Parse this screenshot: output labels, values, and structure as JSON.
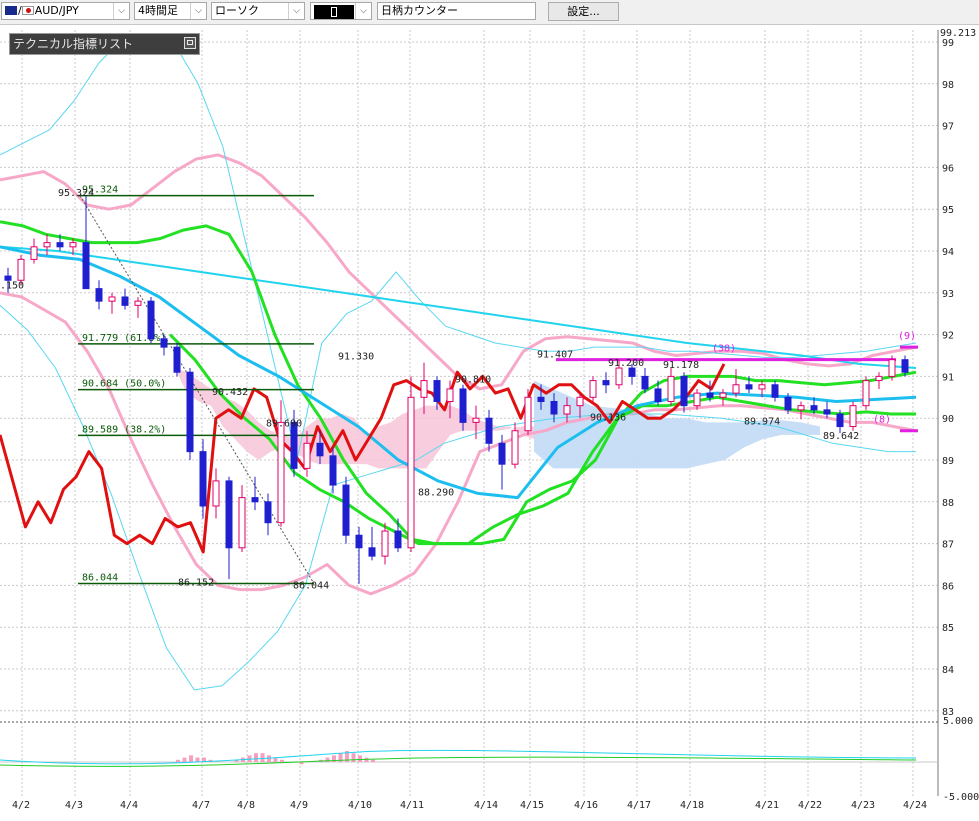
{
  "toolbar": {
    "symbol": "AUD/JPY",
    "timeframe": "4時間足",
    "chart_style": "ローソク",
    "color_sample": "",
    "counter_label": "日柄カウンター",
    "settings_label": "設定..."
  },
  "indicator_panel": {
    "title": "テクニカル指標リスト"
  },
  "colors": {
    "up_candle": "#ffffff",
    "down_candle": "#1f1fd0",
    "grid": "#c9c9c9",
    "cloud_bull": "#f7c5d8",
    "cloud_bear": "#c4dcf5",
    "bb_outer": "#f7a8c8",
    "bb_inner": "#59d7f0",
    "ma_short": "#22d3ee",
    "ma_mid": "#22e022",
    "tenkan": "#e01010",
    "fib": "#0a5a0a",
    "counter": "#e020e0"
  },
  "chart_data": {
    "type": "candlestick",
    "instrument": "AUD/JPY",
    "timeframe": "4h",
    "yticks": [
      99,
      98,
      97,
      96,
      95,
      94,
      93,
      92,
      91,
      90,
      89,
      88,
      87,
      86,
      85,
      84,
      83
    ],
    "top_label": "99.213",
    "x_labels": [
      "4/2",
      "4/3",
      "4/4",
      "4/7",
      "4/8",
      "4/9",
      "4/10",
      "4/11",
      "4/14",
      "4/15",
      "4/16",
      "4/17",
      "4/18",
      "4/21",
      "4/22",
      "4/23",
      "4/24"
    ],
    "oscillator": {
      "upper": "5.000",
      "lower": "-5.000"
    },
    "fibonacci": [
      {
        "label": "95.324",
        "value": 95.324
      },
      {
        "label": "91.779 (61.8%)",
        "value": 91.779
      },
      {
        "label": "90.684 (50.0%)",
        "value": 90.684
      },
      {
        "label": "89.589 (38.2%)",
        "value": 89.589
      },
      {
        "label": "86.044",
        "value": 86.044
      }
    ],
    "price_labels": [
      {
        "text": "95.324",
        "value": 95.32
      },
      {
        "text": ".150",
        "value": 93.1
      },
      {
        "text": "86.152",
        "value": 86.0
      },
      {
        "text": "90.432",
        "value": 90.55
      },
      {
        "text": "89.690",
        "value": 89.8
      },
      {
        "text": "86.044",
        "value": 85.92
      },
      {
        "text": "91.330",
        "value": 91.4
      },
      {
        "text": "88.290",
        "value": 88.15
      },
      {
        "text": "90.810",
        "value": 90.85
      },
      {
        "text": "91.407",
        "value": 91.45
      },
      {
        "text": "91.200",
        "value": 91.25
      },
      {
        "text": "90.136",
        "value": 89.95
      },
      {
        "text": "91.178",
        "value": 91.2
      },
      {
        "text": "89.974",
        "value": 89.85
      },
      {
        "text": "89.642",
        "value": 89.5
      }
    ],
    "counter_labels": [
      {
        "text": "(38)",
        "value": 91.6
      },
      {
        "text": "(9)",
        "value": 91.9
      },
      {
        "text": "(8)",
        "value": 89.9
      }
    ],
    "counter_levels": [
      91.4,
      91.7,
      89.7
    ],
    "candles": [
      {
        "o": 93.4,
        "h": 93.6,
        "l": 93.0,
        "c": 93.3
      },
      {
        "o": 93.3,
        "h": 93.9,
        "l": 93.2,
        "c": 93.8
      },
      {
        "o": 93.8,
        "h": 94.3,
        "l": 93.7,
        "c": 94.1
      },
      {
        "o": 94.1,
        "h": 94.4,
        "l": 93.9,
        "c": 94.2
      },
      {
        "o": 94.2,
        "h": 94.4,
        "l": 94.0,
        "c": 94.1
      },
      {
        "o": 94.1,
        "h": 94.3,
        "l": 93.9,
        "c": 94.2
      },
      {
        "o": 94.2,
        "h": 95.32,
        "l": 94.0,
        "c": 93.1
      },
      {
        "o": 93.1,
        "h": 93.3,
        "l": 92.6,
        "c": 92.8
      },
      {
        "o": 92.8,
        "h": 93.0,
        "l": 92.5,
        "c": 92.9
      },
      {
        "o": 92.9,
        "h": 93.1,
        "l": 92.6,
        "c": 92.7
      },
      {
        "o": 92.7,
        "h": 92.9,
        "l": 92.4,
        "c": 92.8
      },
      {
        "o": 92.8,
        "h": 92.9,
        "l": 91.8,
        "c": 91.9
      },
      {
        "o": 91.9,
        "h": 92.0,
        "l": 91.5,
        "c": 91.7
      },
      {
        "o": 91.7,
        "h": 91.8,
        "l": 91.0,
        "c": 91.1
      },
      {
        "o": 91.1,
        "h": 91.2,
        "l": 89.0,
        "c": 89.2
      },
      {
        "o": 89.2,
        "h": 89.5,
        "l": 87.6,
        "c": 87.9
      },
      {
        "o": 87.9,
        "h": 88.8,
        "l": 87.6,
        "c": 88.5
      },
      {
        "o": 88.5,
        "h": 88.6,
        "l": 86.15,
        "c": 86.9
      },
      {
        "o": 86.9,
        "h": 88.4,
        "l": 86.8,
        "c": 88.1
      },
      {
        "o": 88.1,
        "h": 88.6,
        "l": 87.8,
        "c": 88.0
      },
      {
        "o": 88.0,
        "h": 88.2,
        "l": 87.2,
        "c": 87.5
      },
      {
        "o": 87.5,
        "h": 90.43,
        "l": 87.4,
        "c": 89.9
      },
      {
        "o": 89.9,
        "h": 90.2,
        "l": 88.6,
        "c": 88.8
      },
      {
        "o": 88.8,
        "h": 89.69,
        "l": 88.6,
        "c": 89.4
      },
      {
        "o": 89.4,
        "h": 89.7,
        "l": 88.9,
        "c": 89.1
      },
      {
        "o": 89.1,
        "h": 89.3,
        "l": 88.2,
        "c": 88.4
      },
      {
        "o": 88.4,
        "h": 88.6,
        "l": 87.0,
        "c": 87.2
      },
      {
        "o": 87.2,
        "h": 87.4,
        "l": 86.04,
        "c": 86.9
      },
      {
        "o": 86.9,
        "h": 87.4,
        "l": 86.6,
        "c": 86.7
      },
      {
        "o": 86.7,
        "h": 87.5,
        "l": 86.5,
        "c": 87.3
      },
      {
        "o": 87.3,
        "h": 87.6,
        "l": 86.8,
        "c": 86.9
      },
      {
        "o": 86.9,
        "h": 91.0,
        "l": 86.8,
        "c": 90.5
      },
      {
        "o": 90.5,
        "h": 91.33,
        "l": 90.1,
        "c": 90.9
      },
      {
        "o": 90.9,
        "h": 91.0,
        "l": 90.2,
        "c": 90.4
      },
      {
        "o": 90.4,
        "h": 90.9,
        "l": 90.0,
        "c": 90.7
      },
      {
        "o": 90.7,
        "h": 90.8,
        "l": 89.7,
        "c": 89.9
      },
      {
        "o": 89.9,
        "h": 90.3,
        "l": 89.5,
        "c": 90.0
      },
      {
        "o": 90.0,
        "h": 90.2,
        "l": 89.2,
        "c": 89.4
      },
      {
        "o": 89.4,
        "h": 89.6,
        "l": 88.29,
        "c": 88.9
      },
      {
        "o": 88.9,
        "h": 89.9,
        "l": 88.8,
        "c": 89.7
      },
      {
        "o": 89.7,
        "h": 90.7,
        "l": 89.6,
        "c": 90.5
      },
      {
        "o": 90.5,
        "h": 90.81,
        "l": 90.2,
        "c": 90.4
      },
      {
        "o": 90.4,
        "h": 90.6,
        "l": 89.9,
        "c": 90.1
      },
      {
        "o": 90.1,
        "h": 90.5,
        "l": 89.9,
        "c": 90.3
      },
      {
        "o": 90.3,
        "h": 90.6,
        "l": 90.0,
        "c": 90.5
      },
      {
        "o": 90.5,
        "h": 91.0,
        "l": 90.4,
        "c": 90.9
      },
      {
        "o": 90.9,
        "h": 91.1,
        "l": 90.6,
        "c": 90.8
      },
      {
        "o": 90.8,
        "h": 91.407,
        "l": 90.7,
        "c": 91.2
      },
      {
        "o": 91.2,
        "h": 91.3,
        "l": 90.8,
        "c": 91.0
      },
      {
        "o": 91.0,
        "h": 91.2,
        "l": 90.6,
        "c": 90.7
      },
      {
        "o": 90.7,
        "h": 90.9,
        "l": 90.3,
        "c": 90.4
      },
      {
        "o": 90.4,
        "h": 91.2,
        "l": 90.3,
        "c": 91.0
      },
      {
        "o": 91.0,
        "h": 91.1,
        "l": 90.136,
        "c": 90.3
      },
      {
        "o": 90.3,
        "h": 90.7,
        "l": 90.2,
        "c": 90.6
      },
      {
        "o": 90.6,
        "h": 90.9,
        "l": 90.4,
        "c": 90.5
      },
      {
        "o": 90.5,
        "h": 90.7,
        "l": 90.3,
        "c": 90.6
      },
      {
        "o": 90.6,
        "h": 91.178,
        "l": 90.5,
        "c": 90.8
      },
      {
        "o": 90.8,
        "h": 91.0,
        "l": 90.6,
        "c": 90.7
      },
      {
        "o": 90.7,
        "h": 90.9,
        "l": 90.5,
        "c": 90.8
      },
      {
        "o": 90.8,
        "h": 90.9,
        "l": 90.4,
        "c": 90.5
      },
      {
        "o": 90.5,
        "h": 90.6,
        "l": 90.1,
        "c": 90.2
      },
      {
        "o": 90.2,
        "h": 90.4,
        "l": 89.974,
        "c": 90.3
      },
      {
        "o": 90.3,
        "h": 90.5,
        "l": 90.1,
        "c": 90.2
      },
      {
        "o": 90.2,
        "h": 90.4,
        "l": 90.0,
        "c": 90.1
      },
      {
        "o": 90.1,
        "h": 90.2,
        "l": 89.642,
        "c": 89.8
      },
      {
        "o": 89.8,
        "h": 90.4,
        "l": 89.7,
        "c": 90.3
      },
      {
        "o": 90.3,
        "h": 91.0,
        "l": 90.2,
        "c": 90.9
      },
      {
        "o": 90.9,
        "h": 91.1,
        "l": 90.7,
        "c": 91.0
      },
      {
        "o": 91.0,
        "h": 91.5,
        "l": 90.9,
        "c": 91.4
      },
      {
        "o": 91.4,
        "h": 91.5,
        "l": 91.0,
        "c": 91.1
      }
    ],
    "bb_upper": [
      95.7,
      95.8,
      95.9,
      95.6,
      95.1,
      95.0,
      95.1,
      95.5,
      95.9,
      96.2,
      96.3,
      96.1,
      95.8,
      95.3,
      94.8,
      94.2,
      93.5,
      93.0,
      92.5,
      92.0,
      91.5,
      91.0,
      90.7,
      90.8,
      91.6,
      91.9,
      91.95,
      91.9,
      91.85,
      91.8,
      91.6,
      91.5,
      91.55,
      91.6,
      91.6,
      91.55,
      91.4,
      91.3,
      91.25,
      91.3,
      91.5,
      91.6,
      91.7
    ],
    "bb_lower": [
      93.0,
      92.9,
      92.6,
      92.3,
      91.6,
      90.7,
      89.5,
      88.4,
      87.4,
      86.5,
      86.0,
      85.9,
      85.9,
      86.0,
      86.2,
      86.5,
      86.0,
      85.8,
      86.0,
      86.3,
      87.0,
      88.0,
      89.2,
      89.4,
      89.6,
      89.7,
      89.9,
      90.0,
      90.1,
      90.1,
      90.2,
      90.2,
      90.25,
      90.3,
      90.3,
      90.25,
      90.2,
      90.1,
      90.0,
      89.9,
      89.9,
      89.8,
      89.7
    ],
    "bb2_upper": [
      96.3,
      96.6,
      96.9,
      97.6,
      98.5,
      99.1,
      99.2,
      99.0,
      98.0,
      96.5,
      94.0,
      91.5,
      89.0,
      91.8,
      92.5,
      92.8,
      93.5,
      92.8,
      92.2,
      92.0,
      91.8,
      91.7,
      91.6,
      91.6,
      91.7,
      91.7,
      91.7,
      91.6,
      91.6,
      91.55,
      91.5,
      91.45,
      91.45,
      91.5,
      91.55,
      91.6,
      91.7,
      91.8
    ],
    "bb2_lower": [
      92.7,
      92.1,
      91.2,
      89.8,
      88.2,
      86.3,
      84.5,
      83.5,
      83.6,
      84.2,
      84.9,
      86.0,
      88.4,
      88.6,
      88.8,
      89.0,
      89.4,
      89.6,
      89.8,
      89.9,
      90.0,
      90.05,
      90.1,
      90.1,
      90.1,
      90.05,
      90.0,
      89.9,
      89.8,
      89.6,
      89.4,
      89.3,
      89.2,
      89.2
    ],
    "ma_mid": [
      94.7,
      94.6,
      94.4,
      94.3,
      94.2,
      94.2,
      94.2,
      94.3,
      94.5,
      94.6,
      94.4,
      93.5,
      92.0,
      90.8,
      90.0,
      89.0,
      88.2,
      87.7,
      87.1,
      87.0,
      87.0,
      87.0,
      87.1,
      88.0,
      88.3,
      88.5,
      89.0,
      90.0,
      90.6,
      90.9,
      91.0,
      91.0,
      91.0,
      90.9,
      90.9,
      90.85,
      90.8,
      90.85,
      90.9,
      91.0,
      91.1
    ],
    "ma_mid2": [
      92.0,
      91.4,
      90.6,
      90.0,
      89.5,
      88.7,
      88.3,
      88.0,
      87.6,
      87.3,
      87.0,
      87.0,
      87.0,
      87.4,
      87.7,
      87.9,
      88.2,
      89.2,
      90.0,
      90.3,
      90.3,
      90.4,
      90.5,
      90.4,
      90.3,
      90.2,
      90.15,
      90.1,
      90.15,
      90.1,
      90.1
    ],
    "ma_short": [
      94.1,
      93.9,
      93.8,
      93.4,
      92.9,
      92.2,
      91.5,
      91.0,
      90.4,
      89.8,
      89.0,
      88.5,
      88.2,
      88.1,
      89.3,
      89.9,
      90.3,
      90.5,
      90.6,
      90.55,
      90.5,
      90.4,
      90.45,
      90.5
    ],
    "long_ma": [
      94.1,
      94.0,
      93.8,
      93.6,
      93.4,
      93.2,
      93.0,
      92.8,
      92.6,
      92.4,
      92.2,
      92.0,
      91.8,
      91.65,
      91.5,
      91.3,
      91.2
    ],
    "tenkan": [
      89.6,
      88.5,
      87.4,
      88.0,
      87.5,
      88.3,
      88.6,
      89.2,
      88.8,
      87.2,
      87.0,
      87.2,
      87.0,
      87.6,
      87.4,
      87.5,
      86.8,
      90.0,
      90.2,
      90.0,
      90.7,
      90.5,
      89.5,
      89.2,
      88.8,
      89.8,
      89.2,
      89.7,
      89.0,
      89.5,
      90.0,
      90.8,
      90.9,
      90.7,
      90.6,
      90.2,
      91.1,
      90.7,
      91.0,
      90.6,
      90.7,
      90.0,
      90.8,
      90.6,
      90.8,
      90.8,
      90.5,
      90.3,
      89.9,
      90.4,
      90.2,
      90.0,
      90.0,
      90.2,
      90.5,
      90.9,
      90.7,
      91.3
    ],
    "cloud_top": [
      91.2,
      91.1,
      90.9,
      90.7,
      90.5,
      90.4,
      90.2,
      89.9,
      89.7,
      89.6,
      89.5,
      89.8,
      90.0,
      90.0,
      90.1,
      90.0,
      89.6,
      89.8,
      89.9,
      90.1,
      90.2,
      90.3,
      90.3,
      90.3,
      90.2,
      90.0,
      89.9,
      89.8,
      89.8,
      89.6,
      89.5
    ],
    "cloud_bottom": [
      91.2,
      90.6,
      90.4,
      90.3,
      89.8,
      89.5,
      89.2,
      89.0,
      89.2,
      89.3,
      89.2,
      89.0,
      88.9,
      88.9,
      88.9,
      88.9,
      88.9,
      88.8,
      88.8,
      88.8,
      88.8,
      88.8,
      89.2,
      89.6,
      89.7,
      89.7,
      89.7,
      89.7,
      89.75,
      89.8,
      89.8
    ]
  }
}
